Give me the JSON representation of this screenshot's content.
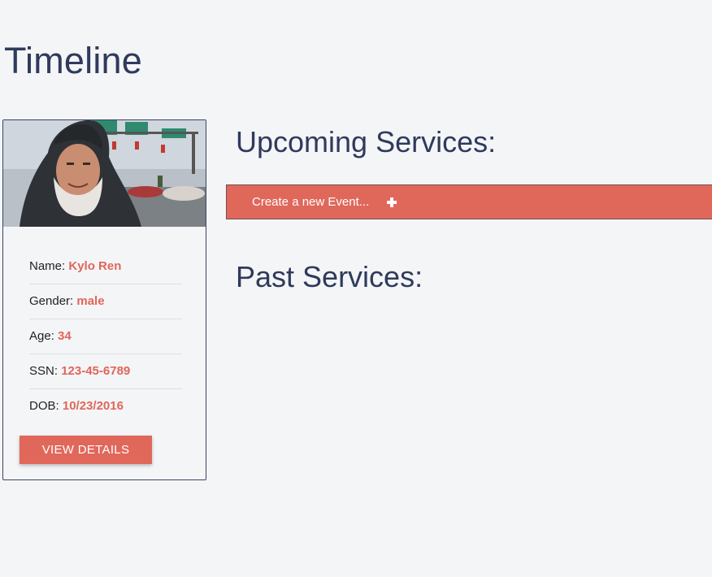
{
  "page": {
    "title": "Timeline"
  },
  "profile": {
    "photo_alt": "profile photo",
    "fields": [
      {
        "label": "Name:",
        "value": "Kylo Ren"
      },
      {
        "label": "Gender:",
        "value": "male"
      },
      {
        "label": "Age:",
        "value": "34"
      },
      {
        "label": "SSN:",
        "value": "123-45-6789"
      },
      {
        "label": "DOB:",
        "value": "10/23/2016"
      }
    ],
    "view_details_label": "VIEW DETAILS"
  },
  "services": {
    "upcoming_heading": "Upcoming Services:",
    "create_event_label": "Create a new Event...",
    "create_event_icon": "plus-icon",
    "past_heading": "Past Services:"
  },
  "colors": {
    "background": "#f4f5f7",
    "heading": "#2f3a5c",
    "accent": "#e0685b",
    "value_text": "#e0665a"
  }
}
